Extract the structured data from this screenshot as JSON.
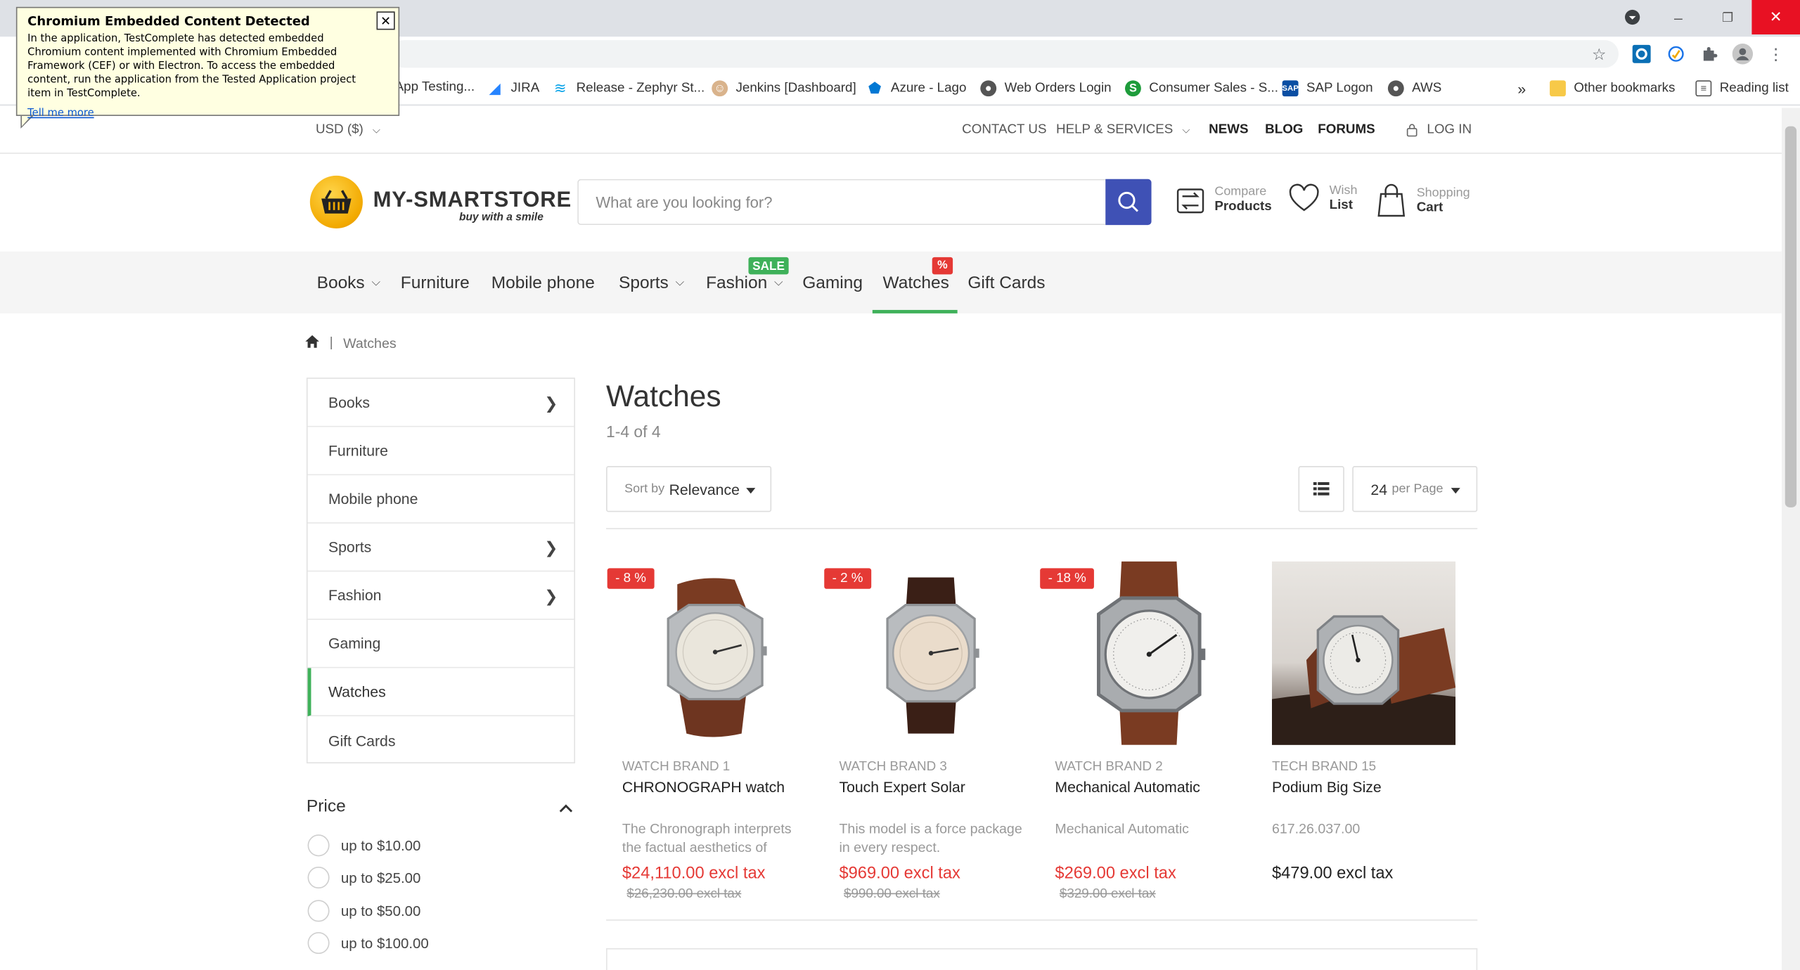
{
  "bookmarks": {
    "items": [
      {
        "label": "App Testing...",
        "icon": "page-icon"
      },
      {
        "label": "JIRA",
        "icon": "jira-icon"
      },
      {
        "label": "Release - Zephyr St...",
        "icon": "zephyr-icon"
      },
      {
        "label": "Jenkins [Dashboard]",
        "icon": "jenkins-icon"
      },
      {
        "label": "Azure - Lago",
        "icon": "azure-icon"
      },
      {
        "label": "Web Orders Login",
        "icon": "globe-icon"
      },
      {
        "label": "Consumer Sales - S...",
        "icon": "sales-icon"
      },
      {
        "label": "SAP Logon",
        "icon": "sap-icon"
      },
      {
        "label": "AWS",
        "icon": "globe-icon"
      }
    ],
    "overflow": "»",
    "other": "Other bookmarks",
    "reading_list": "Reading list"
  },
  "topbar": {
    "currency": "USD ($)",
    "contact": "CONTACT US",
    "help": "HELP & SERVICES",
    "news": "NEWS",
    "blog": "BLOG",
    "forums": "FORUMS",
    "login": "LOG IN"
  },
  "header": {
    "logo_text": "MY-SMARTSTORE",
    "logo_tagline": "buy with a smile",
    "search_placeholder": "What are you looking for?",
    "compare_top": "Compare",
    "compare_bottom": "Products",
    "wish_top": "Wish",
    "wish_bottom": "List",
    "cart_top": "Shopping",
    "cart_bottom": "Cart"
  },
  "nav": {
    "items": [
      "Books",
      "Furniture",
      "Mobile phone",
      "Sports",
      "Fashion",
      "Gaming",
      "Watches",
      "Gift Cards"
    ],
    "sale_badge": "SALE",
    "pct_badge": "%",
    "active": "Watches",
    "accent": "#3fb15a"
  },
  "breadcrumb": {
    "separator": "|",
    "current": "Watches"
  },
  "sidebar": {
    "categories": [
      "Books",
      "Furniture",
      "Mobile phone",
      "Sports",
      "Fashion",
      "Gaming",
      "Watches",
      "Gift Cards"
    ],
    "price_title": "Price",
    "price_options": [
      "up to $10.00",
      "up to $25.00",
      "up to $50.00",
      "up to $100.00"
    ]
  },
  "listing": {
    "title": "Watches",
    "count": "1-4 of 4",
    "sort_prefix": "Sort by",
    "sort_value": "Relevance",
    "per_page_value": "24",
    "per_page_suffix": "per Page"
  },
  "products": [
    {
      "badge": "- 8 %",
      "brand": "WATCH BRAND 1",
      "name": "CHRONOGRAPH watch",
      "desc": "The Chronograph interprets the factual aesthetics of",
      "price": "$24,110.00 excl tax",
      "old_price": "$26,230.00 excl tax"
    },
    {
      "badge": "- 2 %",
      "brand": "WATCH BRAND 3",
      "name": "Touch Expert Solar",
      "desc": "This model is a force package in every respect.",
      "price": "$969.00 excl tax",
      "old_price": "$990.00 excl tax"
    },
    {
      "badge": "- 18 %",
      "brand": "WATCH BRAND 2",
      "name": "Mechanical Automatic",
      "desc": "Mechanical Automatic",
      "price": "$269.00 excl tax",
      "old_price": "$329.00 excl tax"
    },
    {
      "badge": "",
      "brand": "TECH BRAND 15",
      "name": "Podium Big Size",
      "desc": "617.26.037.00",
      "price": "$479.00 excl tax",
      "old_price": ""
    }
  ],
  "tooltip": {
    "title": "Chromium Embedded Content Detected",
    "body": "In the application, TestComplete has detected embedded Chromium content implemented with Chromium Embedded Framework (CEF) or with Electron. To access the embedded content, run the application from the Tested Application project item in TestComplete.",
    "link": "Tell me more"
  }
}
